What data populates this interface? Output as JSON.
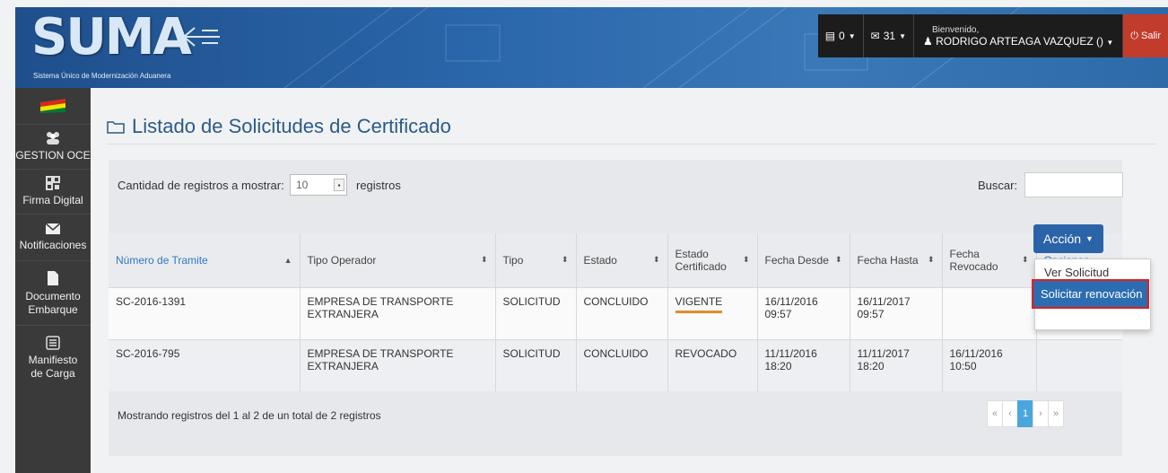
{
  "header": {
    "logo_text": "SUMA",
    "logo_subtitle": "Sistema Único de Modernización Aduanera",
    "messages_count": "0",
    "mail_count": "31",
    "welcome": "Bienvenido,",
    "username": "RODRIGO ARTEAGA VAZQUEZ ()",
    "logout": "Salir"
  },
  "sidebar": {
    "items": [
      {
        "label": "GESTION OCE",
        "icon": "users-icon"
      },
      {
        "label": "Firma Digital",
        "icon": "qrcode-icon"
      },
      {
        "label": "Notificaciones",
        "icon": "envelope-icon"
      },
      {
        "label": "Documento Embarque",
        "icon": "document-icon"
      },
      {
        "label": "Manifiesto de Carga",
        "icon": "list-icon"
      }
    ]
  },
  "page": {
    "title": "Listado de Solicitudes de Certificado",
    "show_label": "Cantidad de registros a mostrar:",
    "page_size": "10",
    "records_label": "registros",
    "search_label": "Buscar:",
    "search_value": ""
  },
  "table": {
    "headers": [
      "Número de Tramite",
      "Tipo Operador",
      "Tipo",
      "Estado",
      "Estado Certificado",
      "Fecha Desde",
      "Fecha Hasta",
      "Fecha Revocado",
      "Opciones"
    ],
    "rows": [
      {
        "numero": "SC-2016-1391",
        "operador": "EMPRESA DE TRANSPORTE EXTRANJERA",
        "tipo": "SOLICITUD",
        "estado": "CONCLUIDO",
        "estado_cert": "VIGENTE",
        "desde": "16/11/2016 09:57",
        "hasta": "16/11/2017 09:57",
        "revocado": ""
      },
      {
        "numero": "SC-2016-795",
        "operador": "EMPRESA DE TRANSPORTE EXTRANJERA",
        "tipo": "SOLICITUD",
        "estado": "CONCLUIDO",
        "estado_cert": "REVOCADO",
        "desde": "11/11/2016 18:20",
        "hasta": "11/11/2017 18:20",
        "revocado": "16/11/2016 10:50"
      }
    ]
  },
  "actions": {
    "button_label": "Acción",
    "menu": [
      "Ver Solicitud",
      "Solicitar renovación"
    ]
  },
  "footer": {
    "summary": "Mostrando registros del 1 al 2 de un total de 2 registros",
    "pager": [
      "«",
      "‹",
      "1",
      "›",
      "»"
    ]
  }
}
